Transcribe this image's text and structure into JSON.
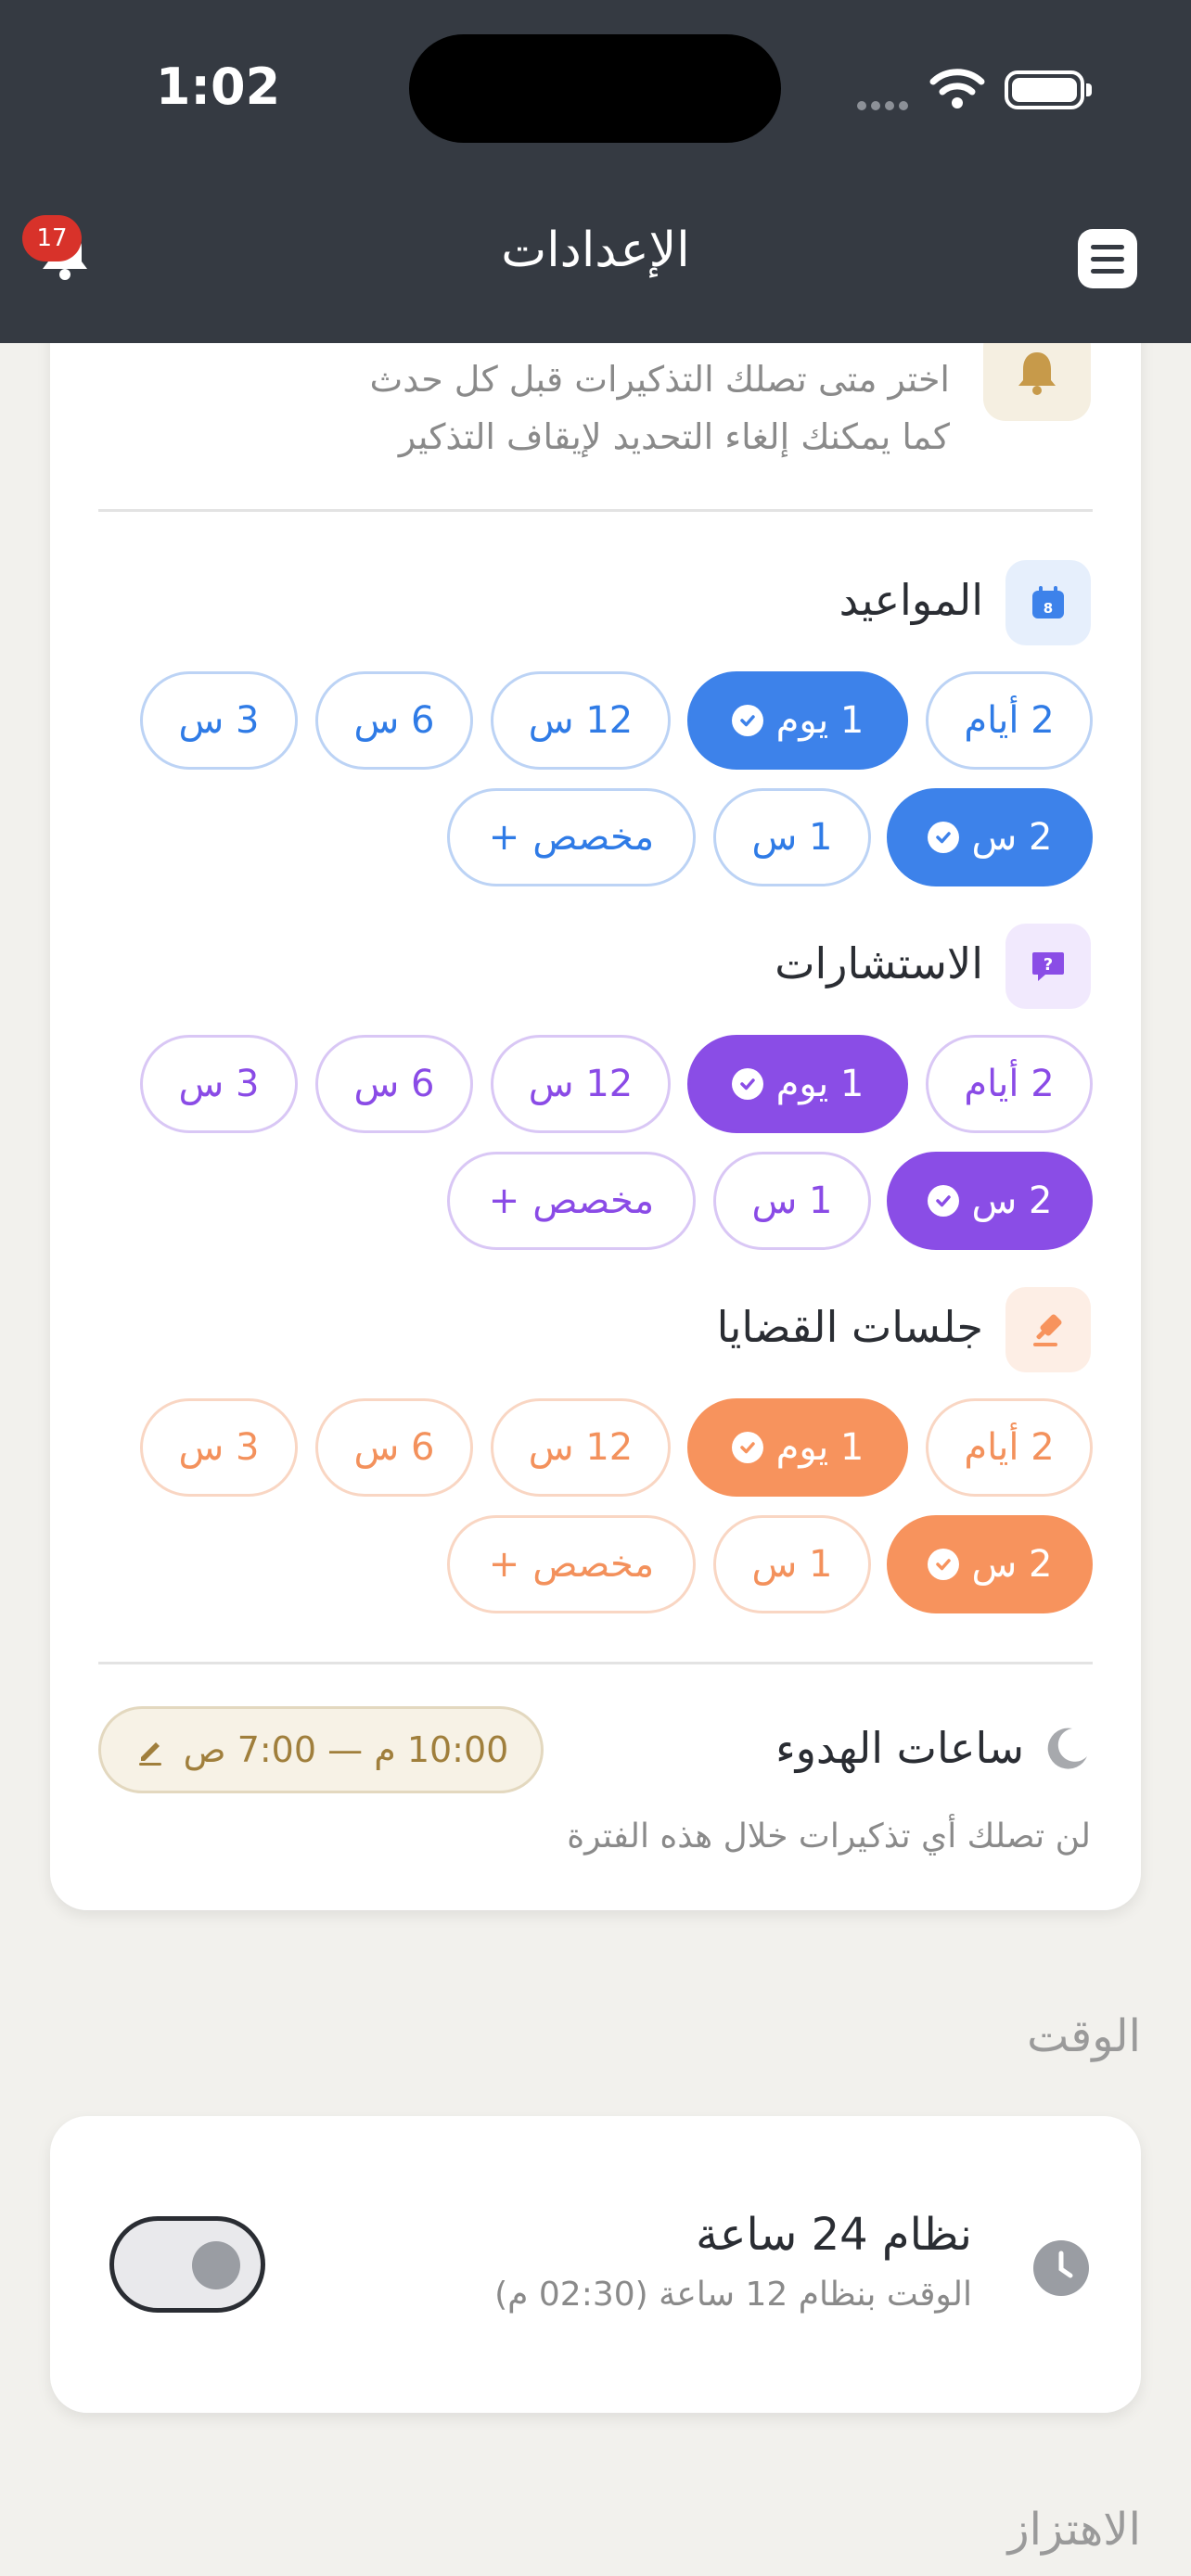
{
  "status_bar": {
    "time": "1:02"
  },
  "header": {
    "title": "الإعدادات",
    "notification_count": "17"
  },
  "reminders": {
    "intro_line1": "اختر متى تصلك التذكيرات قبل كل حدث",
    "intro_line2": "كما يمكنك إلغاء التحديد لإيقاف التذكير",
    "sections": [
      {
        "title": "المواعيد",
        "color": "#3d82ea",
        "row1": [
          "2 أيام",
          "1 يوم",
          "12 س",
          "6 س",
          "3 س"
        ],
        "row2": [
          "2 س",
          "1 س",
          "مخصص"
        ],
        "selected": [
          "1 يوم",
          "2 س"
        ]
      },
      {
        "title": "الاستشارات",
        "color": "#8a4de6",
        "row1": [
          "2 أيام",
          "1 يوم",
          "12 س",
          "6 س",
          "3 س"
        ],
        "row2": [
          "2 س",
          "1 س",
          "مخصص"
        ],
        "selected": [
          "1 يوم",
          "2 س"
        ]
      },
      {
        "title": "جلسات القضايا",
        "color": "#f7935d",
        "row1": [
          "2 أيام",
          "1 يوم",
          "12 س",
          "6 س",
          "3 س"
        ],
        "row2": [
          "2 س",
          "1 س",
          "مخصص"
        ],
        "selected": [
          "1 يوم",
          "2 س"
        ]
      }
    ],
    "quiet_hours": {
      "title": "ساعات الهدوء",
      "range": "10:00 م — 7:00 ص",
      "note": "لن تصلك أي تذكيرات خلال هذه الفترة"
    }
  },
  "time_section": {
    "heading": "الوقت",
    "title": "نظام 24 ساعة",
    "subtitle": "الوقت بنظام 12 ساعة (02:30 م)",
    "toggle_on": false
  },
  "vibration_section": {
    "heading": "الاهتزاز"
  }
}
